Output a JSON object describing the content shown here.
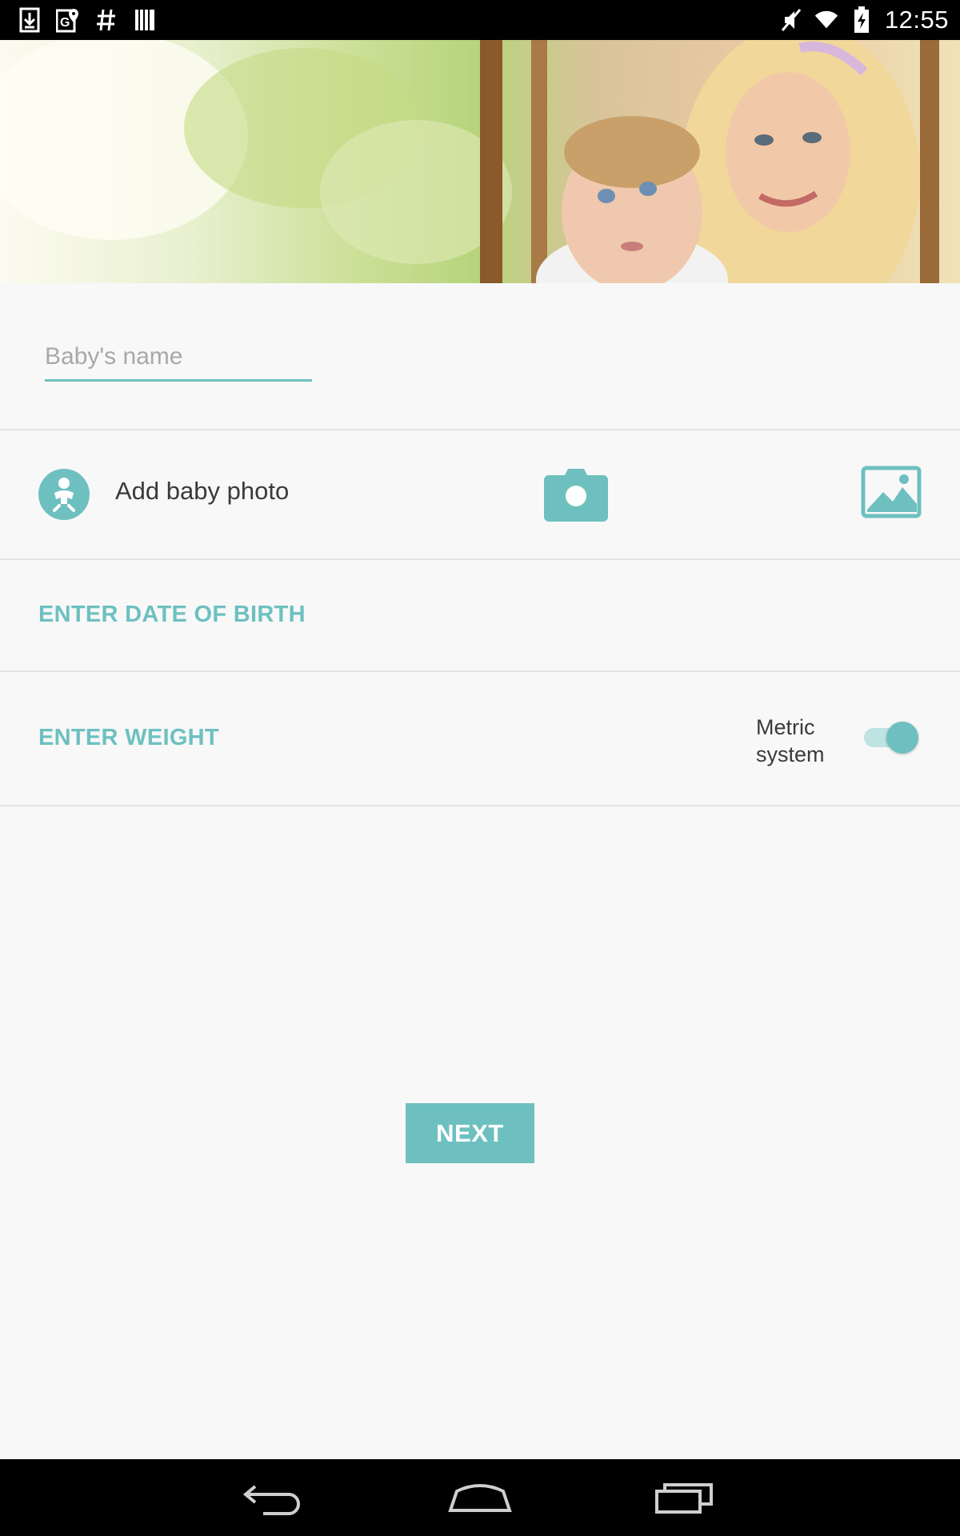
{
  "status_bar": {
    "time": "12:55",
    "left_icons": [
      "download-icon",
      "maps-icon",
      "hash-icon",
      "barcode-icon"
    ],
    "right_icons": [
      "mute-icon",
      "wifi-icon",
      "battery-icon"
    ]
  },
  "hero": {
    "image": "mother-and-baby-photo"
  },
  "form": {
    "name_placeholder": "Baby's name",
    "name_value": "",
    "add_photo_label": "Add baby photo",
    "date_of_birth_label": "ENTER DATE OF BIRTH",
    "weight_label": "ENTER WEIGHT",
    "metric_label_line1": "Metric",
    "metric_label_line2": "system",
    "metric_enabled": true,
    "next_label": "NEXT"
  },
  "nav_bar": {
    "buttons": [
      "back-icon",
      "home-icon",
      "recents-icon"
    ]
  },
  "colors": {
    "accent": "#6ec0c0",
    "accent_light": "#bfe2e2",
    "background": "#f8f8f8",
    "divider": "#e3e3e3"
  }
}
